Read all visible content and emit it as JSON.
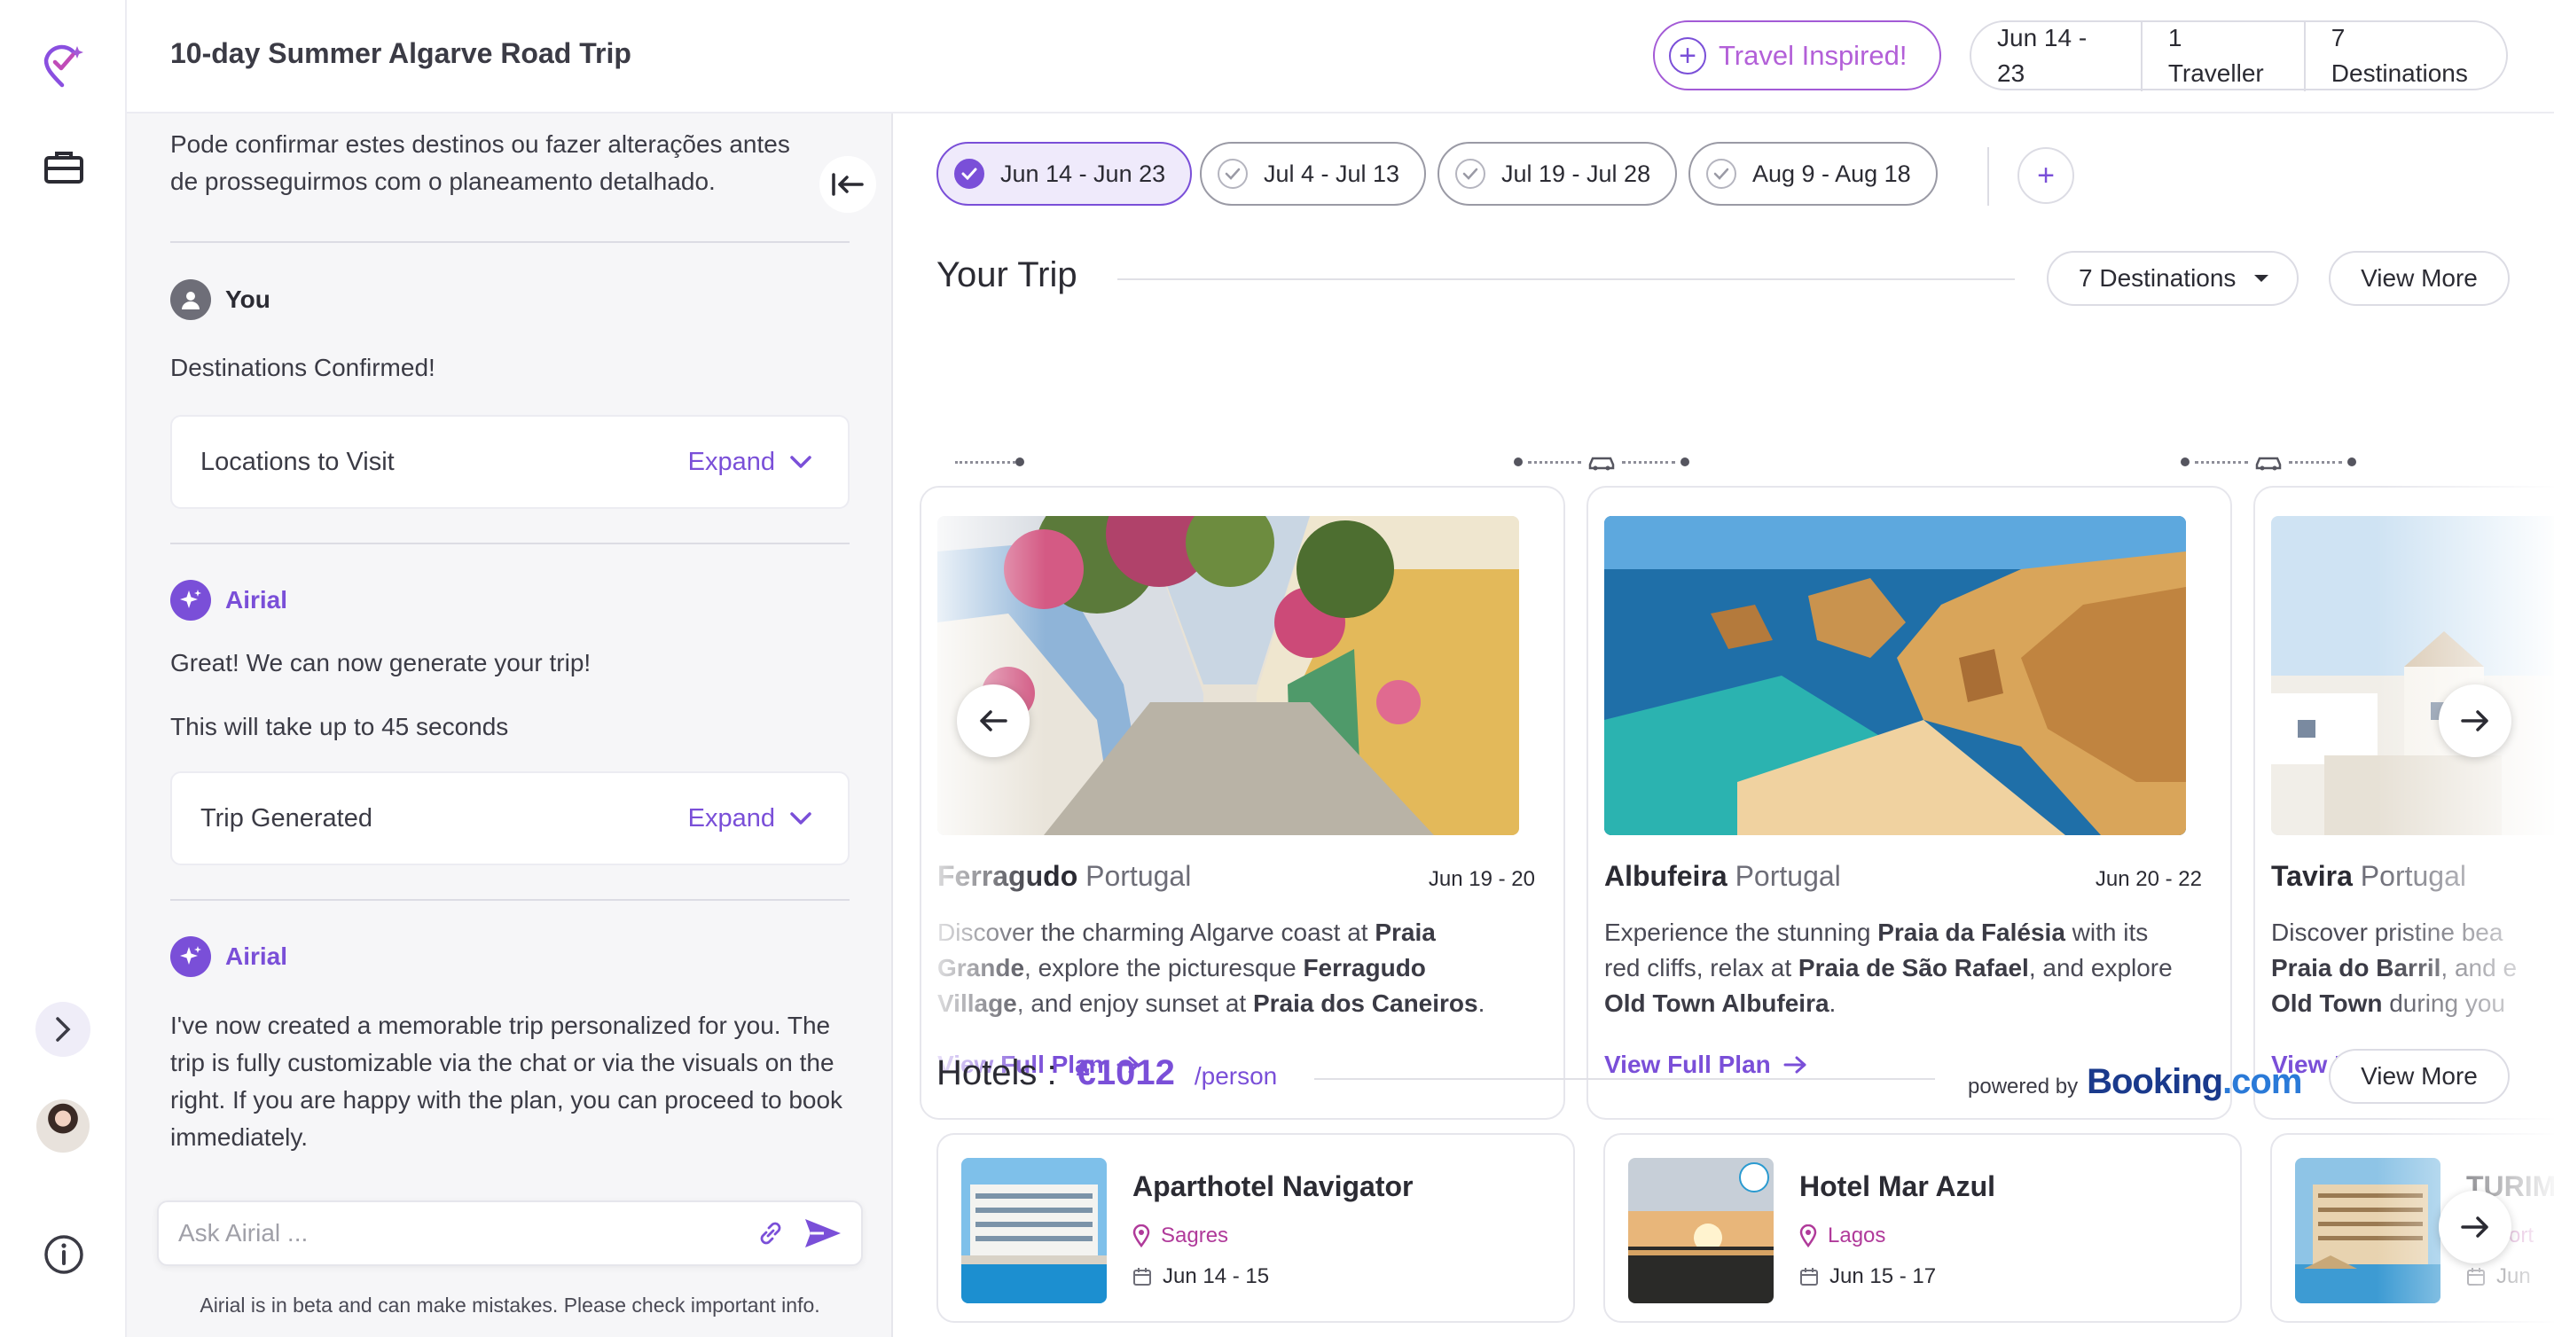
{
  "header": {
    "trip_title": "10-day Summer Algarve Road Trip",
    "inspire_label": "Travel Inspired!",
    "dates": "Jun 14 - 23",
    "travellers": "1 Traveller",
    "destinations": "7 Destinations"
  },
  "chat": {
    "intro": "Pode confirmar estes destinos ou fazer alterações antes de prosseguirmos com o planeamento detalhado.",
    "you_label": "You",
    "you_message": "Destinations Confirmed!",
    "card1": {
      "label": "Locations to Visit",
      "action": "Expand"
    },
    "ai_label": "Airial",
    "ai_message1": "Great! We can now generate your trip!",
    "ai_message2": "This will take up to 45 seconds",
    "card2": {
      "label": "Trip Generated",
      "action": "Expand"
    },
    "ai_label2": "Airial",
    "ai_message3": "I've now created a memorable trip personalized for you. The trip is fully customizable via the chat or via the visuals on the right. If you are happy with the plan, you can proceed to book immediately.",
    "input_placeholder": "Ask Airial ...",
    "disclaimer": "Airial is in beta and can make mistakes. Please check important info."
  },
  "date_tabs": [
    {
      "label": "Jun 14 - Jun 23",
      "active": true
    },
    {
      "label": "Jul 4 - Jul 13",
      "active": false
    },
    {
      "label": "Jul 19 - Jul 28",
      "active": false
    },
    {
      "label": "Aug 9 - Aug 18",
      "active": false
    }
  ],
  "trip_section": {
    "title": "Your Trip",
    "dropdown": "7 Destinations",
    "view_more": "View More"
  },
  "destinations": [
    {
      "city": "Ferragudo",
      "country": "Portugal",
      "dates": "Jun 19 - 20",
      "desc": [
        {
          "t": "Discover the charming Algarve coast at ",
          "b": false
        },
        {
          "t": "Praia Grande",
          "b": true
        },
        {
          "t": ", explore the picturesque ",
          "b": false
        },
        {
          "t": "Ferragudo Village",
          "b": true
        },
        {
          "t": ", and enjoy sunset at ",
          "b": false
        },
        {
          "t": "Praia dos Caneiros",
          "b": true
        },
        {
          "t": ".",
          "b": false
        }
      ],
      "link": "View Full Plan"
    },
    {
      "city": "Albufeira",
      "country": "Portugal",
      "dates": "Jun 20 - 22",
      "desc": [
        {
          "t": "Experience the stunning ",
          "b": false
        },
        {
          "t": "Praia da Falésia",
          "b": true
        },
        {
          "t": " with its red cliffs, relax at ",
          "b": false
        },
        {
          "t": "Praia de São Rafael",
          "b": true
        },
        {
          "t": ", and explore ",
          "b": false
        },
        {
          "t": "Old Town Albufeira",
          "b": true
        },
        {
          "t": ".",
          "b": false
        }
      ],
      "link": "View Full Plan"
    },
    {
      "city": "Tavira",
      "country": "Portugal",
      "dates": "",
      "desc": [
        {
          "t": "Discover pristine bea",
          "b": false
        },
        {
          "t": " Praia do Barril",
          "b": true
        },
        {
          "t": ", and e",
          "b": false
        },
        {
          "t": " Old Town",
          "b": true
        },
        {
          "t": " during you",
          "b": false
        }
      ],
      "link": "View Full Plan"
    }
  ],
  "hotels": {
    "title": "Hotels :",
    "price": "€1012",
    "per": "/person",
    "powered_by": "powered by",
    "booking_brand": "Booking",
    "booking_tld": ".com",
    "view_more": "View More",
    "items": [
      {
        "name": "Aparthotel Navigator",
        "location": "Sagres",
        "dates": "Jun 14 - 15"
      },
      {
        "name": "Hotel Mar Azul",
        "location": "Lagos",
        "dates": "Jun 15 - 17"
      },
      {
        "name": "TURIM",
        "location": "Port",
        "dates": "Jun"
      }
    ]
  },
  "colors": {
    "accent": "#7a4fd8",
    "inspire": "#b360d8",
    "location": "#b03a9a",
    "booking": "#1a3a8c"
  }
}
